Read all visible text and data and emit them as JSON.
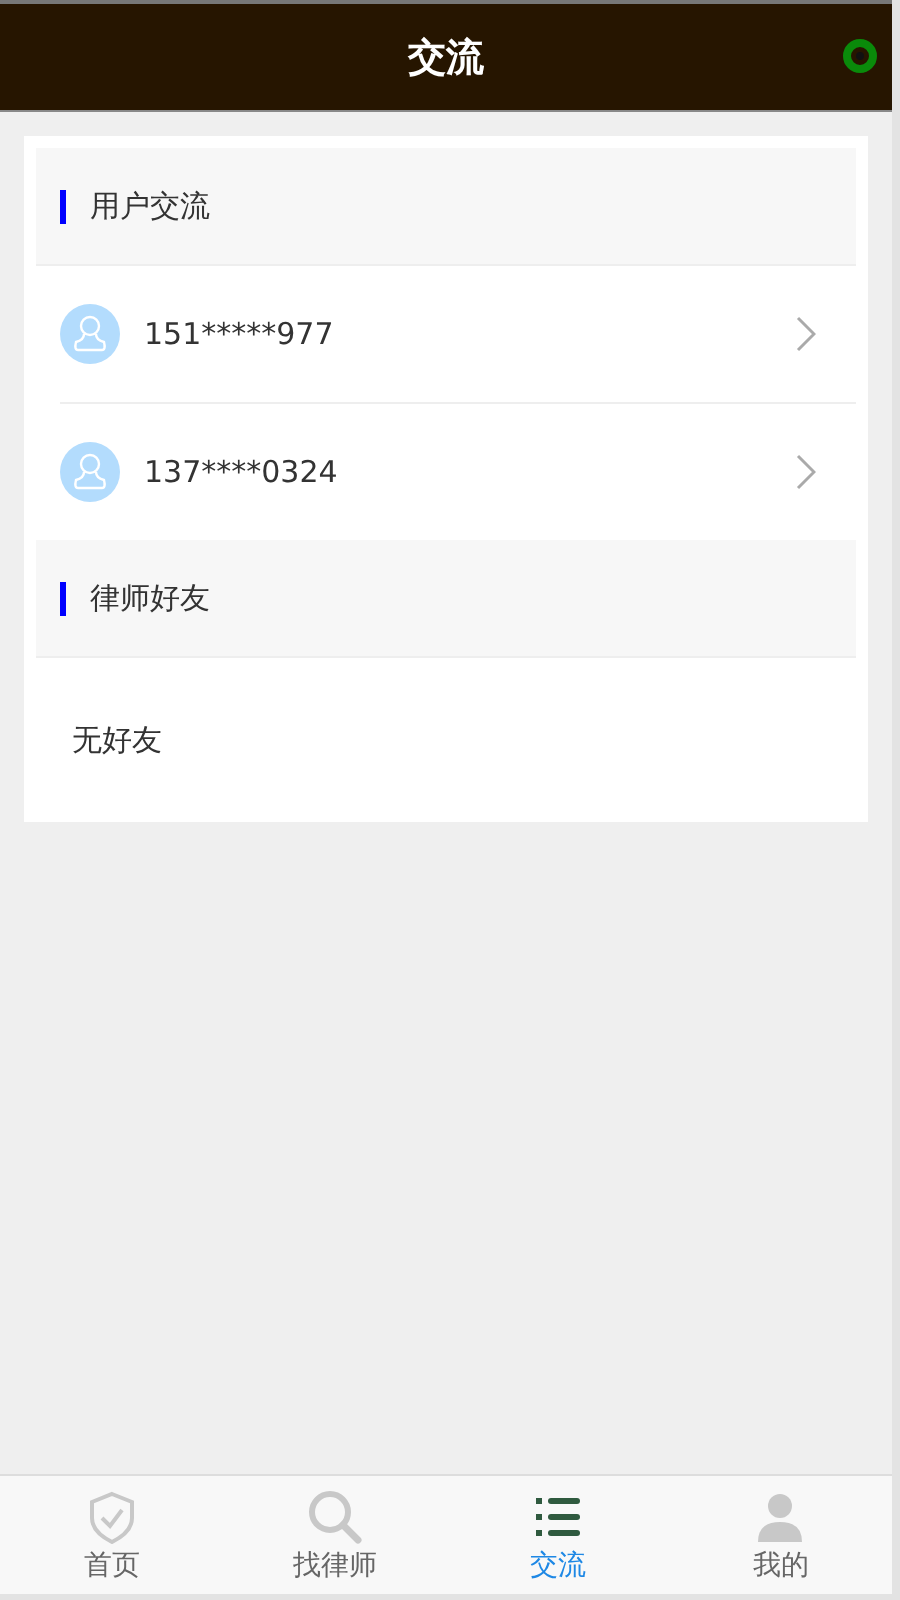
{
  "header": {
    "title": "交流"
  },
  "sections": [
    {
      "title": "用户交流",
      "users": [
        {
          "name": "151*****977"
        },
        {
          "name": "137****0324"
        }
      ]
    },
    {
      "title": "律师好友",
      "empty_text": "无好友"
    }
  ],
  "tabs": [
    {
      "label": "首页",
      "kind": "home",
      "selected": false
    },
    {
      "label": "找律师",
      "kind": "find",
      "selected": false
    },
    {
      "label": "交流",
      "kind": "chat",
      "selected": true
    },
    {
      "label": "我的",
      "kind": "mine",
      "selected": false
    }
  ]
}
